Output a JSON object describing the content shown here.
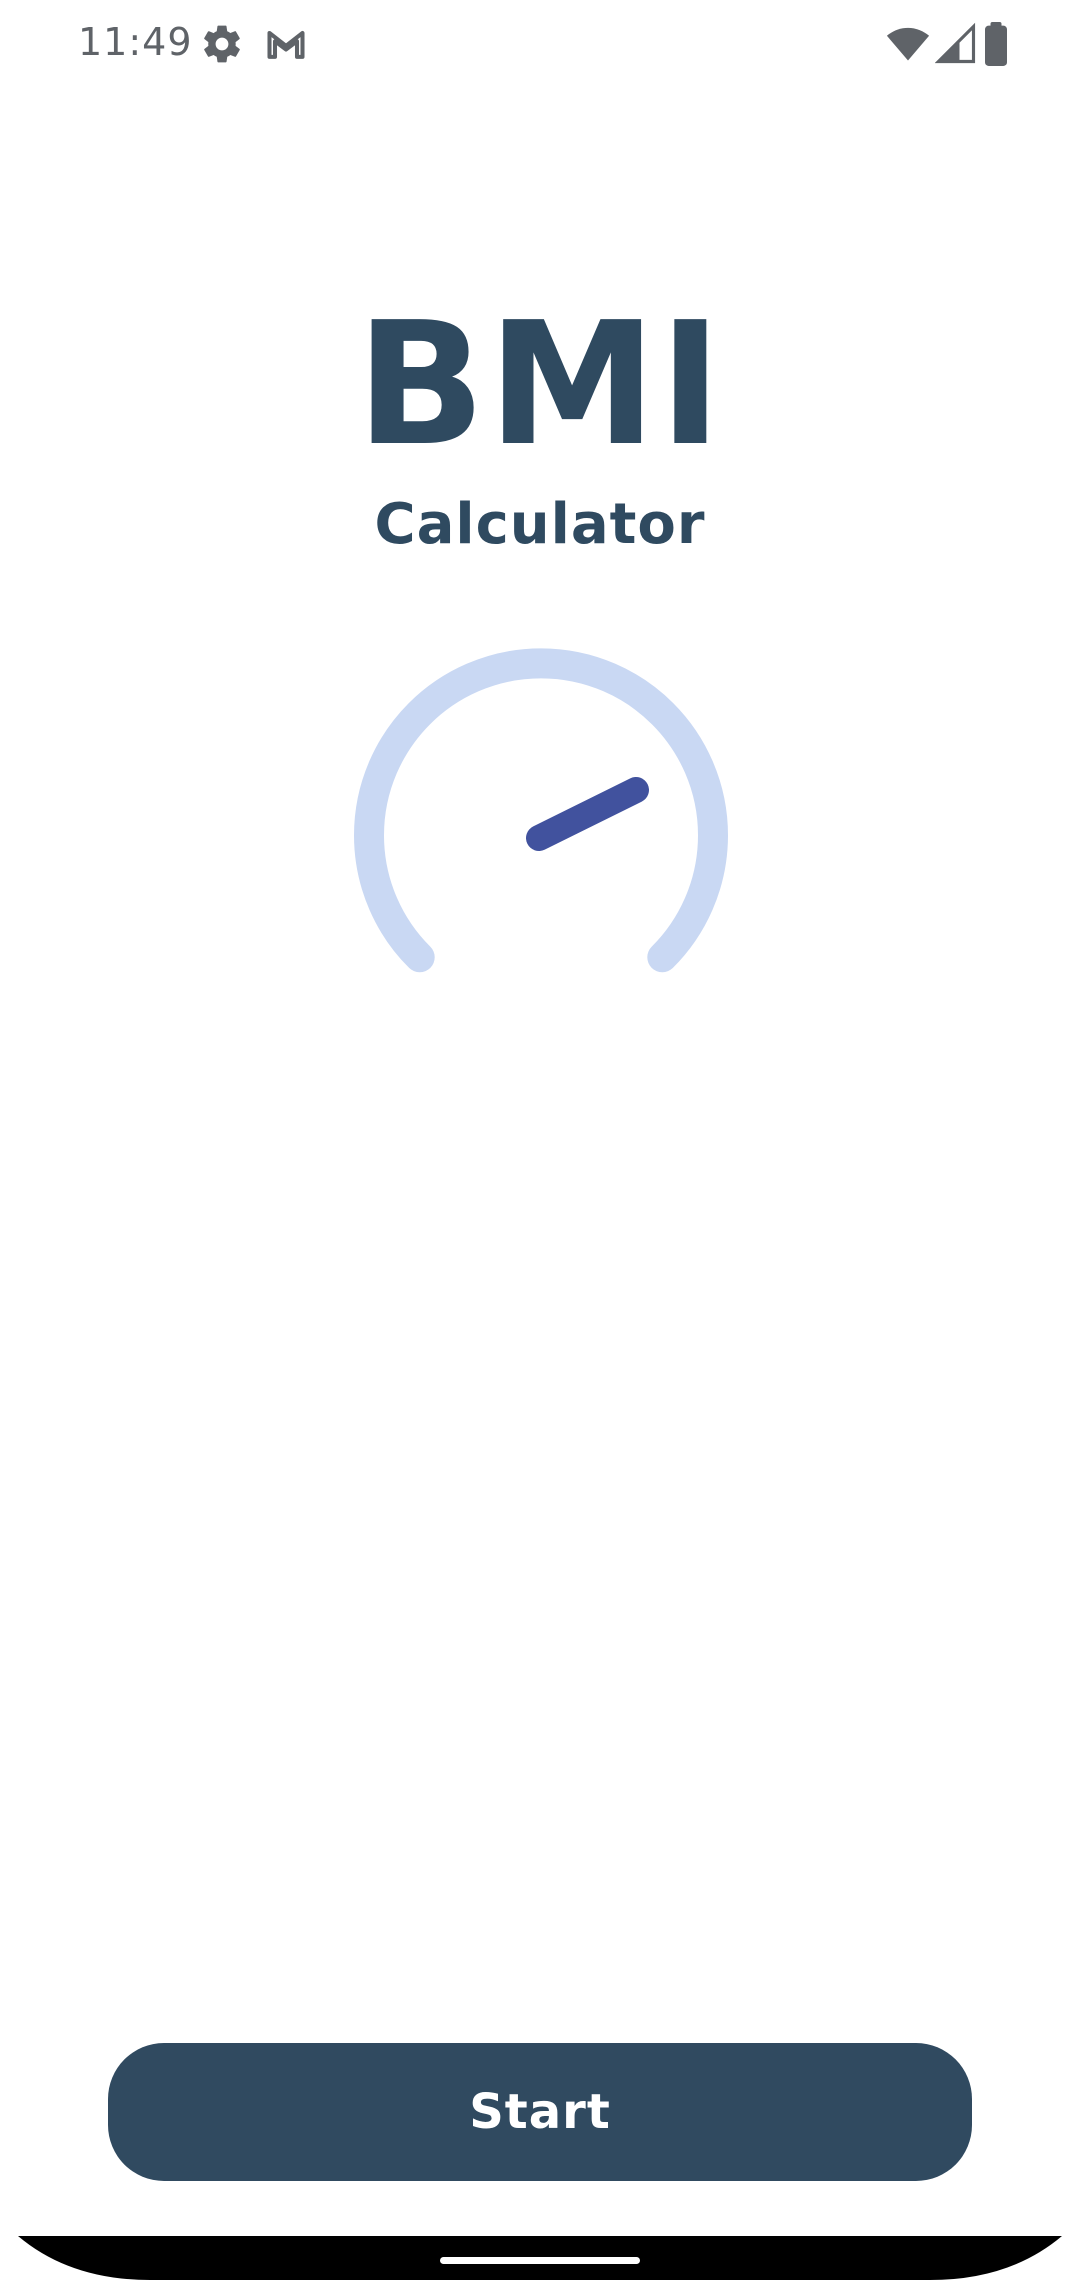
{
  "status_bar": {
    "time": "11:49",
    "icons": [
      "settings-gear-icon",
      "gmail-icon",
      "wifi-icon",
      "cellular-signal-icon",
      "battery-icon"
    ]
  },
  "app": {
    "title": "BMI",
    "subtitle": "Calculator"
  },
  "gauge": {
    "track_color": "#c9d8f3",
    "needle_color": "#41529e"
  },
  "actions": {
    "start_label": "Start"
  },
  "colors": {
    "primary": "#304a60",
    "background": "#ffffff",
    "status_icon": "#5f6368"
  }
}
